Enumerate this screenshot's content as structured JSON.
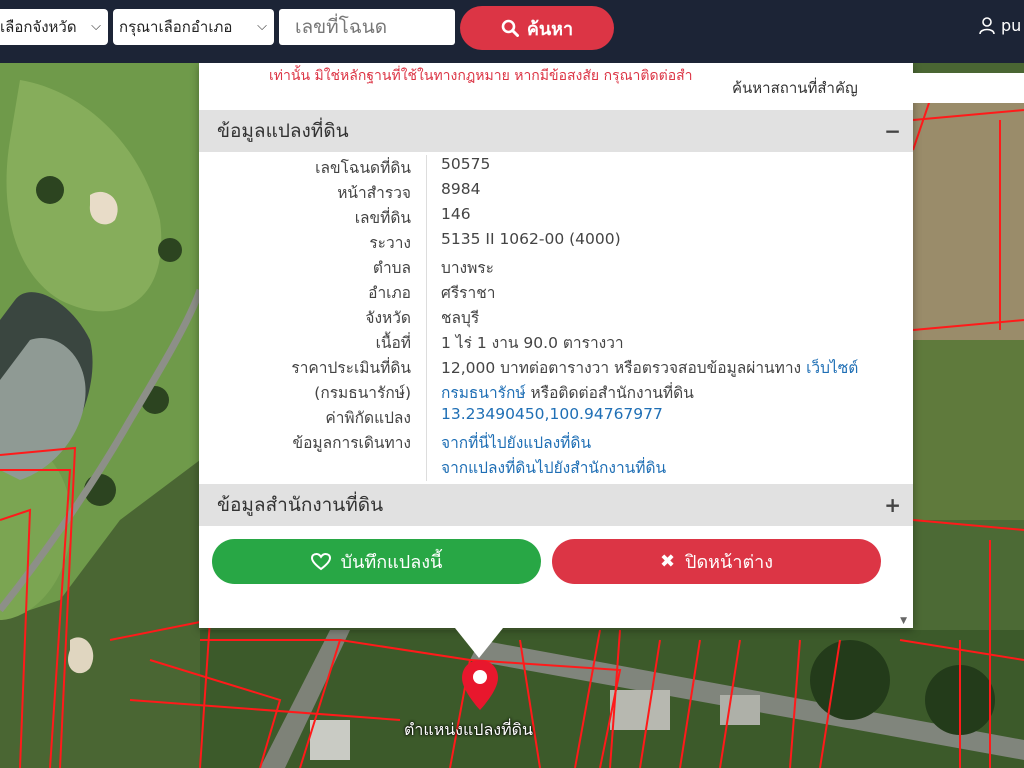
{
  "topbar": {
    "province_select": "เลือกจังหวัด",
    "amphoe_select": "กรุณาเลือกอำเภอ",
    "deed_placeholder": "เลขที่โฉนด",
    "search_label": "ค้นหา",
    "user_label": "pu"
  },
  "notice": "เท่านั้น มิใช่หลักฐานที่ใช้ในทางกฎหมาย หากมีข้อสงสัย กรุณาติดต่อสำ",
  "place_search_placeholder": "ค้นหาสถานที่สำคัญ",
  "land_section": {
    "title": "ข้อมูลแปลงที่ดิน",
    "toggle": "−",
    "rows": [
      {
        "label": "เลขโฉนดที่ดิน",
        "value": "50575"
      },
      {
        "label": "หน้าสำรวจ",
        "value": "8984"
      },
      {
        "label": "เลขที่ดิน",
        "value": "146"
      },
      {
        "label": "ระวาง",
        "value": "5135 II 1062-00 (4000)"
      },
      {
        "label": "ตำบล",
        "value": "บางพระ"
      },
      {
        "label": "อำเภอ",
        "value": "ศรีราชา"
      },
      {
        "label": "จังหวัด",
        "value": "ชลบุรี"
      },
      {
        "label": "เนื้อที่",
        "value": "1 ไร่ 1 งาน 90.0 ตารางวา"
      },
      {
        "label": "ราคาประเมินที่ดิน",
        "value": "12,000 บาทต่อตารางวา หรือตรวจสอบข้อมูลผ่านทาง ",
        "link": "เว็บไซต์"
      },
      {
        "label": "(กรมธนารักษ์)",
        "value": " หรือติดต่อสำนักงานที่ดิน",
        "link": "กรมธนารักษ์"
      },
      {
        "label": "ค่าพิกัดแปลง",
        "value": "13.23490450,100.94767977"
      },
      {
        "label": "ข้อมูลการเดินทาง",
        "value": "จากที่นี่ไปยังแปลงที่ดิน"
      },
      {
        "label": "",
        "value": "จากแปลงที่ดินไปยังสำนักงานที่ดิน"
      }
    ]
  },
  "office_section": {
    "title": "ข้อมูลสำนักงานที่ดิน",
    "toggle": "+"
  },
  "buttons": {
    "save": "บันทึกแปลงนี้",
    "close": "ปิดหน้าต่าง"
  },
  "map": {
    "pin_label": "ตำแหน่งแปลงที่ดิน"
  },
  "colors": {
    "topbar": "#1c2436",
    "accent_red": "#dc3545",
    "accent_green": "#28a745",
    "link": "#1f6fb5",
    "parcel_line": "#ff1a1a"
  }
}
